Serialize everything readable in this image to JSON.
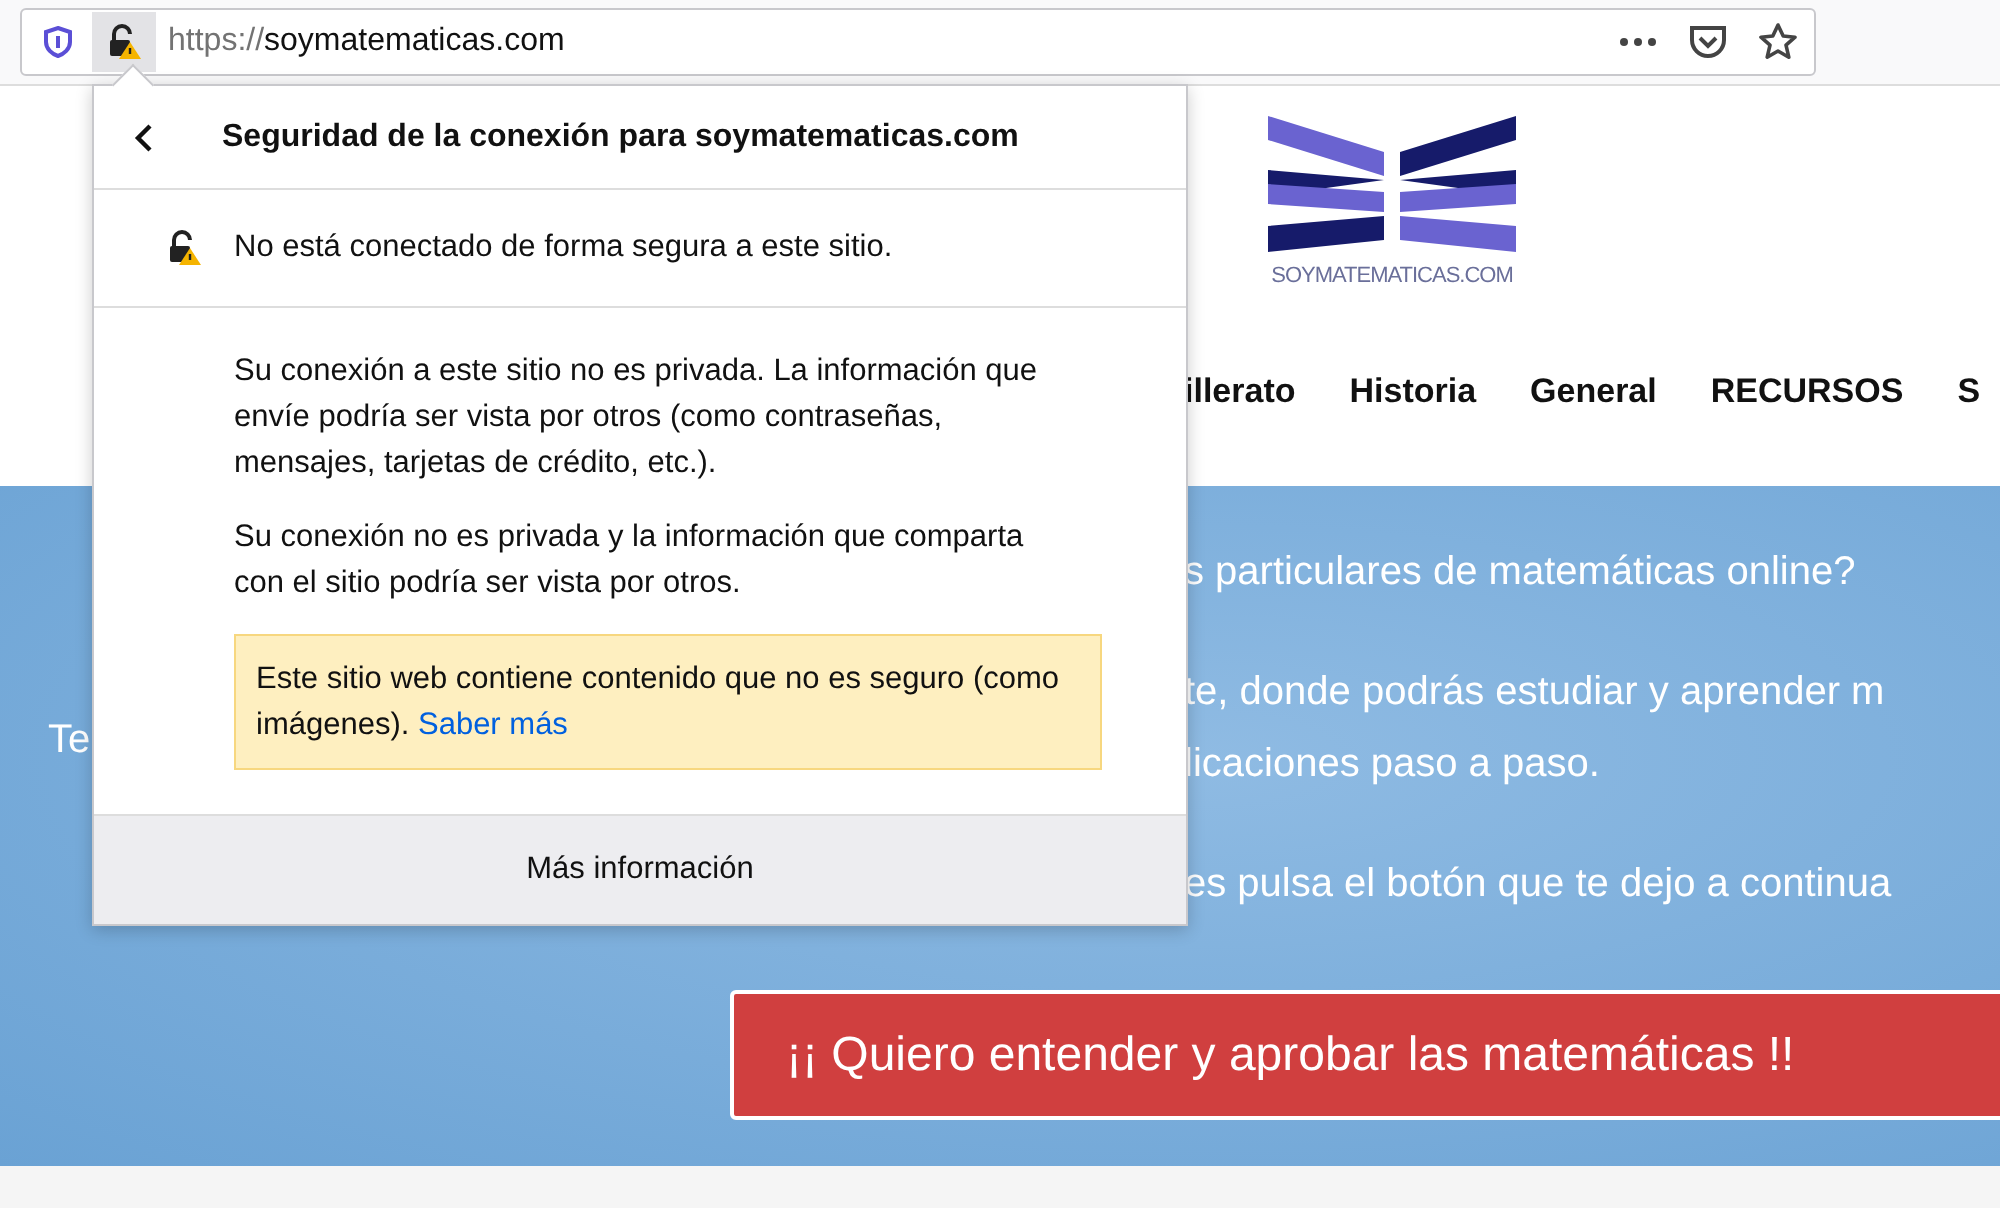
{
  "browser": {
    "url_scheme": "https://",
    "url_host": "soymatematicas.com"
  },
  "popup": {
    "title": "Seguridad de la conexión para soymatematicas.com",
    "status": "No está conectado de forma segura a este sitio.",
    "paragraphs": [
      "Su conexión a este sitio no es privada. La información que envíe podría ser vista por otros (como contraseñas, mensajes, tarjetas de crédito, etc.).",
      "Su conexión no es privada y la información que comparta con el sitio podría ser vista por otros."
    ],
    "warning": {
      "text": "Este sitio web contiene contenido que no es seguro (como imágenes).",
      "link": "Saber más"
    },
    "footer_button": "Más información"
  },
  "site": {
    "logo_text": "SOYMATEMATICAS.COM",
    "nav": [
      "illerato",
      "Historia",
      "General",
      "RECURSOS",
      "S"
    ],
    "hero_left": "Te",
    "hero_paragraphs": [
      [
        "s particulares de matemáticas online?"
      ],
      [
        "te, donde podrás estudiar y aprender m",
        "licaciones paso a paso."
      ],
      [
        "es pulsa el botón que te dejo a continua"
      ]
    ],
    "cta": "¡¡ Quiero entender y aprobar las matemáticas !!"
  }
}
